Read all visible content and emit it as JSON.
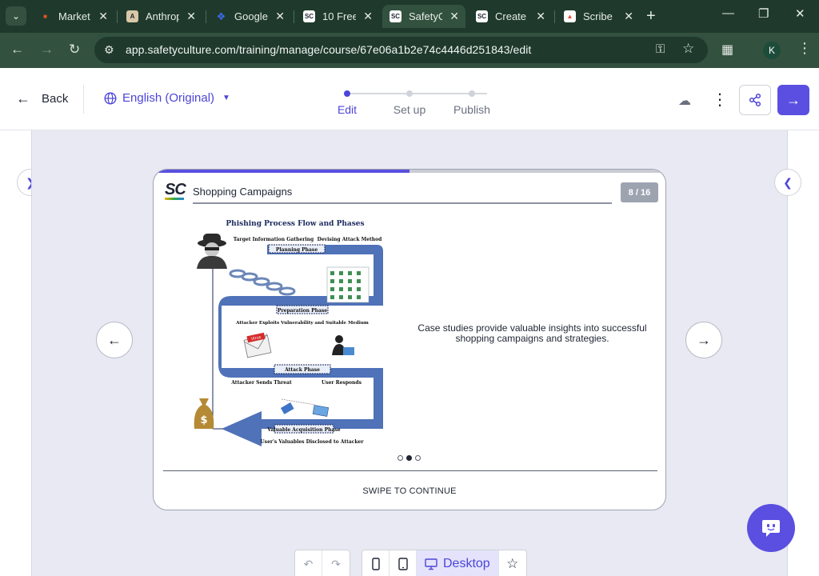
{
  "browser": {
    "tabs": [
      {
        "title": "Market",
        "color": "#e8541e"
      },
      {
        "title": "Anthrop",
        "color": "#d9c7a8"
      },
      {
        "title": "Google",
        "color": "#3c6be8"
      },
      {
        "title": "10 Free",
        "color": "#ffffff"
      },
      {
        "title": "SafetyC",
        "color": "#ffffff"
      },
      {
        "title": "Create",
        "color": "#ffffff"
      },
      {
        "title": "Scribe",
        "color": "#e84a2f"
      }
    ],
    "active_tab_index": 4,
    "url": "app.safetyculture.com/training/manage/course/67e06a1b2e74c4446d251843/edit",
    "profile_initial": "K"
  },
  "header": {
    "back_label": "Back",
    "language": "English (Original)",
    "steps": [
      "Edit",
      "Set up",
      "Publish"
    ],
    "active_step": 0
  },
  "slide": {
    "logo": "SC",
    "title": "Shopping Campaigns",
    "counter": "8 / 16",
    "progress_fraction": 0.5,
    "body_text": "Case studies provide valuable insights into successful shopping campaigns and strategies.",
    "pager_dots": 3,
    "active_dot": 1,
    "swipe_label": "SWIPE TO CONTINUE",
    "figure": {
      "title": "Phishing Process Flow and Phases",
      "labels": {
        "target": "Target Information Gathering",
        "devise": "Devising Attack Method",
        "planning": "Planning Phase",
        "preparation": "Preparation Phase",
        "exploit": "Attacker Exploits Vulnerability and Suitable Medium",
        "attack": "Attack Phase",
        "sends": "Attacker Sends Threat",
        "responds": "User Responds",
        "acquisition": "Valuable Acquisition Phase",
        "disclosed": "User's Valuables Disclosed to Attacker",
        "virus": "Virus"
      }
    }
  },
  "toolbar": {
    "device_label": "Desktop"
  },
  "colors": {
    "accent": "#5a4fe0",
    "chrome_dark": "#1f3a2c",
    "chrome_mid": "#33513f",
    "stage": "#e8e9f3"
  }
}
